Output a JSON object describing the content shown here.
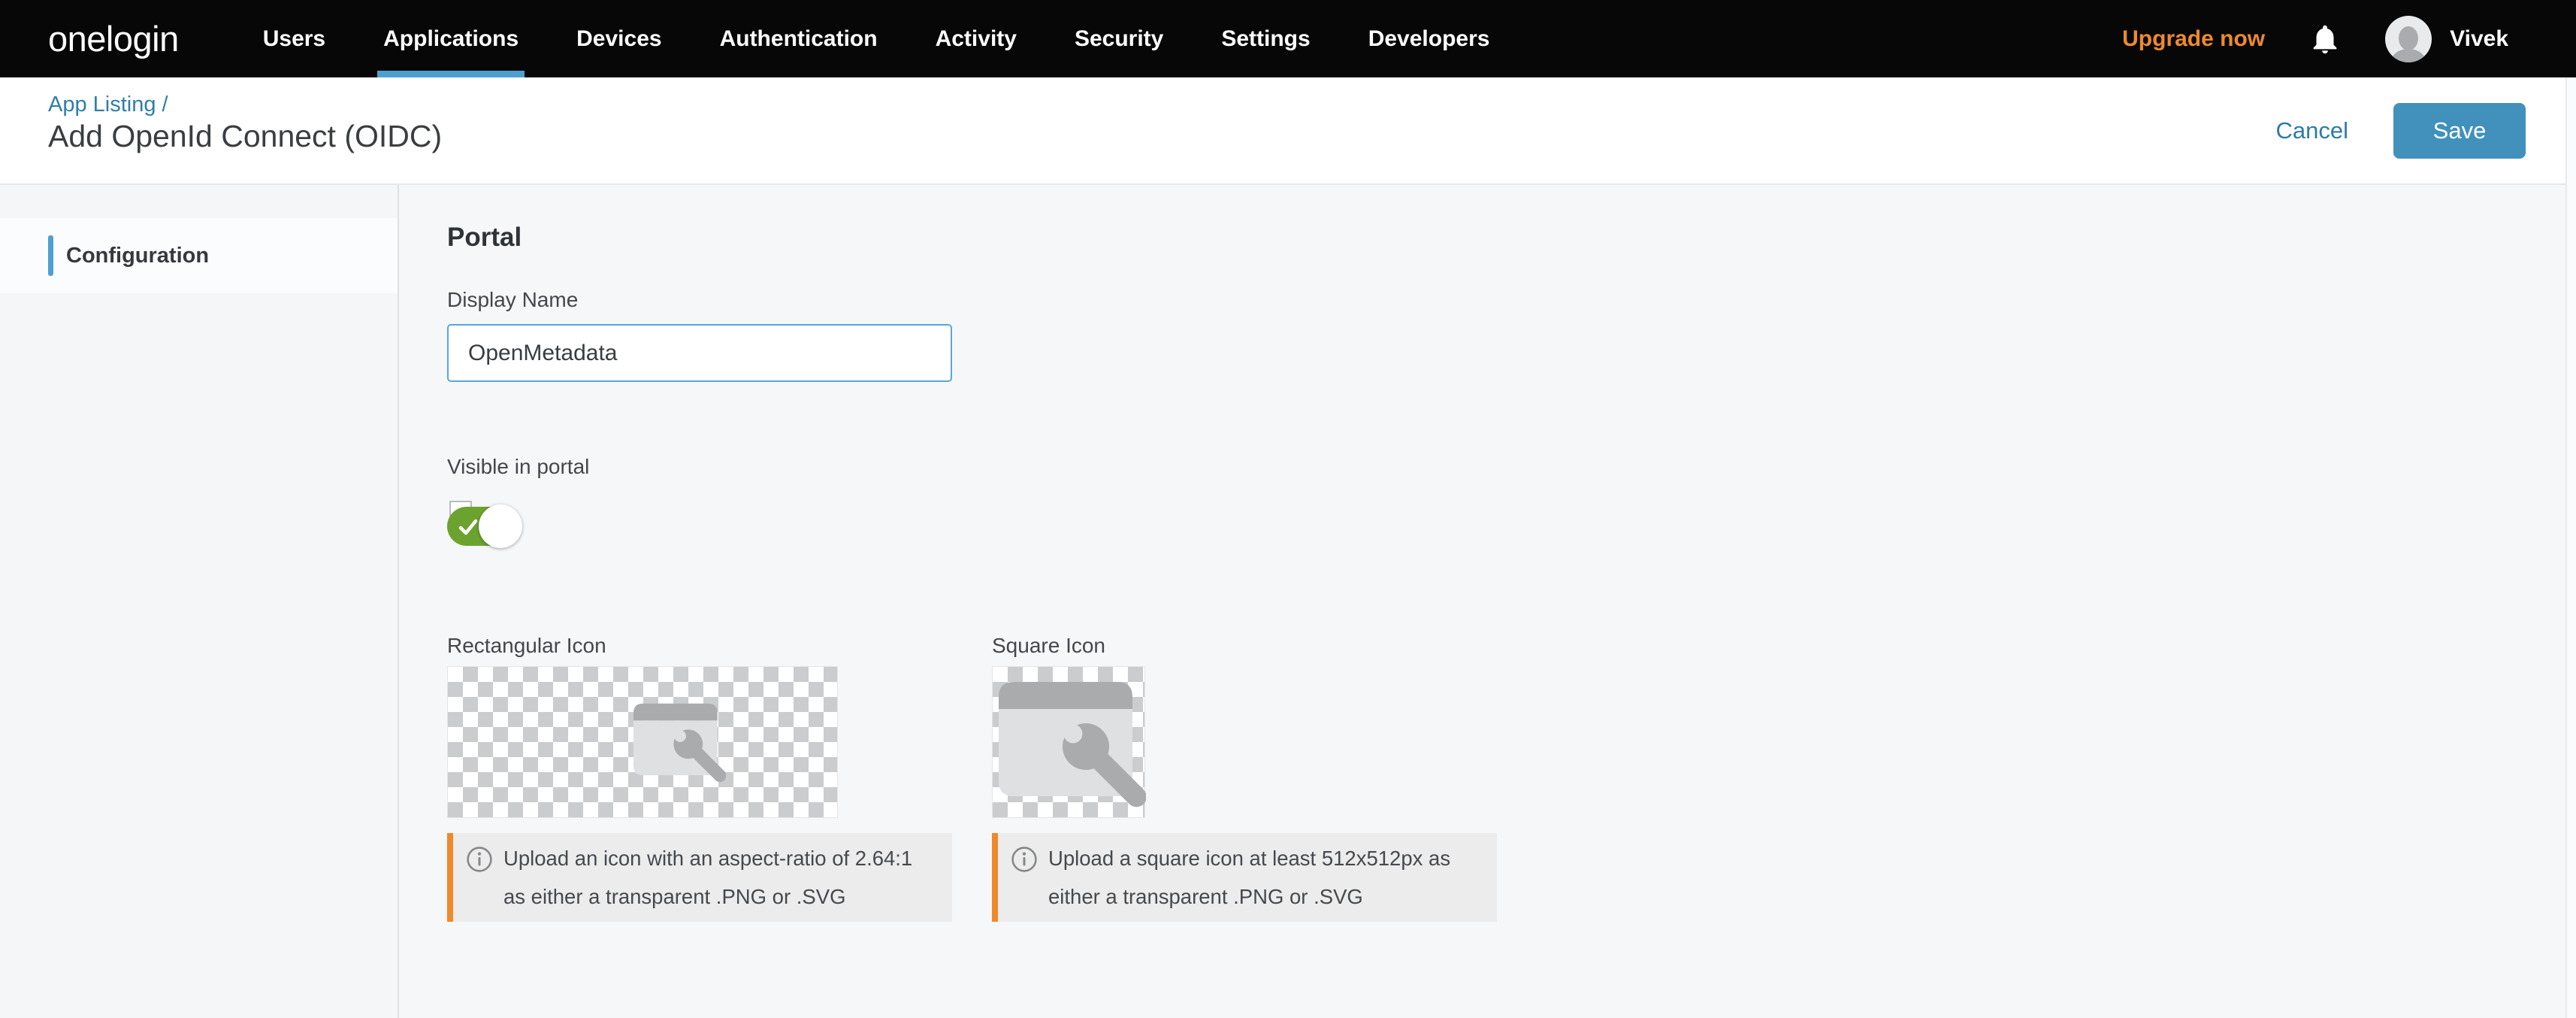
{
  "colors": {
    "nav_bg": "#070707",
    "accent_blue": "#4D9FD0",
    "save_blue": "#4191BC",
    "link_blue": "#2E7CA6",
    "toggle_green": "#6CA32F",
    "upgrade_orange": "#ED8A2E",
    "info_border_orange": "#EE8A2C"
  },
  "navbar": {
    "logo": "onelogin",
    "items": [
      {
        "label": "Users",
        "active": false
      },
      {
        "label": "Applications",
        "active": true
      },
      {
        "label": "Devices",
        "active": false
      },
      {
        "label": "Authentication",
        "active": false
      },
      {
        "label": "Activity",
        "active": false
      },
      {
        "label": "Security",
        "active": false
      },
      {
        "label": "Settings",
        "active": false
      },
      {
        "label": "Developers",
        "active": false
      }
    ],
    "upgrade_label": "Upgrade now",
    "user_name": "Vivek",
    "icons": {
      "notifications": "bell-icon",
      "user": "avatar-person-icon"
    }
  },
  "header": {
    "breadcrumb": "App Listing /",
    "title": "Add OpenId Connect (OIDC)",
    "cancel_label": "Cancel",
    "save_label": "Save"
  },
  "sidebar": {
    "items": [
      {
        "label": "Configuration",
        "active": true
      }
    ]
  },
  "main": {
    "section_title": "Portal",
    "display_name": {
      "label": "Display Name",
      "value": "OpenMetadata"
    },
    "visible_in_portal": {
      "label": "Visible in portal",
      "state": "on"
    },
    "rectangular_icon": {
      "label": "Rectangular Icon",
      "placeholder_icon": "app-window-wrench-icon",
      "info_icon": "info-circle-icon",
      "info_text": "Upload an icon with an aspect-ratio of 2.64:1 as either a transparent .PNG or .SVG"
    },
    "square_icon": {
      "label": "Square Icon",
      "placeholder_icon": "app-window-wrench-icon",
      "info_icon": "info-circle-icon",
      "info_text": "Upload a square icon at least 512x512px as either a transparent .PNG or .SVG"
    }
  }
}
